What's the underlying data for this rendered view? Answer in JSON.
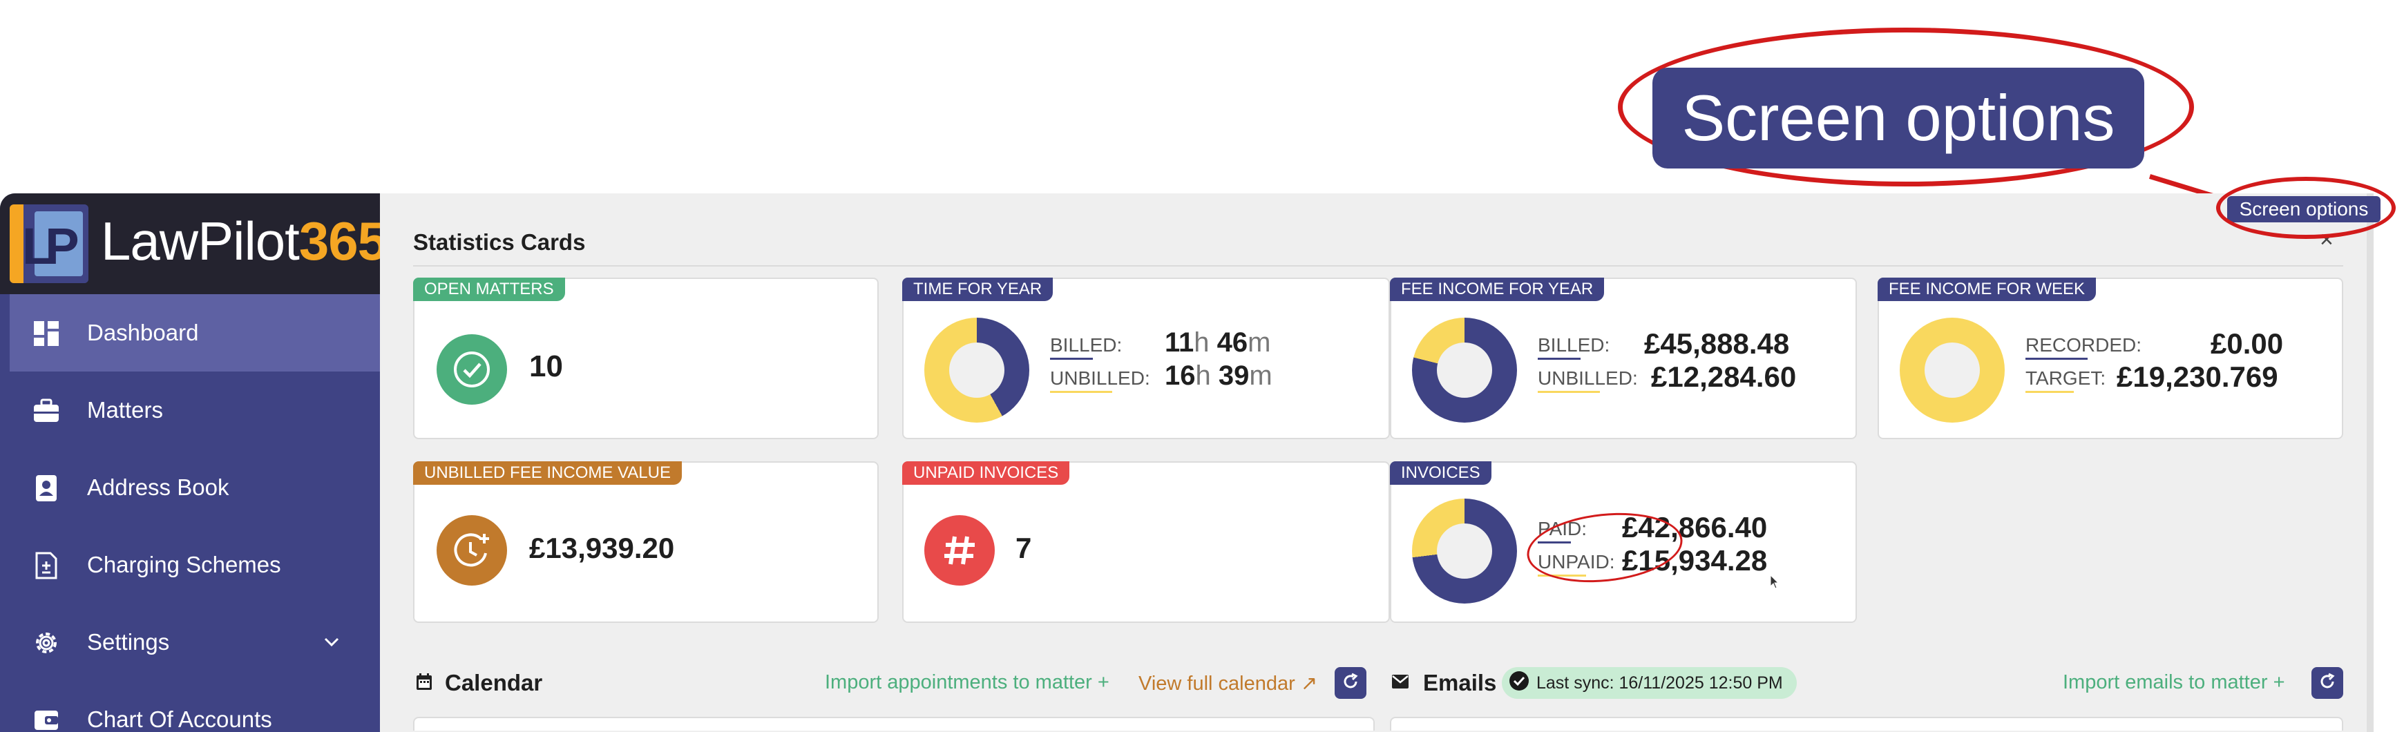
{
  "brand": {
    "name": "LawPilot",
    "number": "365",
    "mark": "LP"
  },
  "sidebar": {
    "items": [
      {
        "label": "Dashboard",
        "icon": "dashboard-icon",
        "active": true
      },
      {
        "label": "Matters",
        "icon": "briefcase-icon"
      },
      {
        "label": "Address Book",
        "icon": "contact-book-icon"
      },
      {
        "label": "Charging Schemes",
        "icon": "fee-document-icon"
      },
      {
        "label": "Settings",
        "icon": "gear-icon",
        "expandable": true
      },
      {
        "label": "Chart Of Accounts",
        "icon": "wallet-icon"
      }
    ]
  },
  "header": {
    "screen_options": "Screen options",
    "close": "×"
  },
  "stats_section": {
    "title": "Statistics Cards"
  },
  "cards": {
    "open_matters": {
      "tag": "OPEN MATTERS",
      "value": "10",
      "icon": "check-circle-icon",
      "color": "#4caf7d"
    },
    "time_for_year": {
      "tag": "TIME FOR YEAR",
      "billed_label": "BILLED:",
      "billed_h": "11",
      "billed_m": "46",
      "unbilled_label": "UNBILLED:",
      "unbilled_h": "16",
      "unbilled_m": "39",
      "h_unit": "h",
      "m_unit": "m",
      "billed_fraction": 0.42
    },
    "fee_income_year": {
      "tag": "FEE INCOME FOR YEAR",
      "billed_label": "BILLED:",
      "billed_value": "£45,888.48",
      "unbilled_label": "UNBILLED:",
      "unbilled_value": "£12,284.60",
      "billed_fraction": 0.79
    },
    "fee_income_week": {
      "tag": "FEE INCOME FOR WEEK",
      "recorded_label": "RECORDED:",
      "recorded_value": "£0.00",
      "target_label": "TARGET:",
      "target_value": "£19,230.769",
      "recorded_fraction": 0
    },
    "unbilled_fee_income": {
      "tag": "UNBILLED FEE INCOME VALUE",
      "value": "£13,939.20",
      "icon": "clock-plus-icon",
      "color": "#c17a2c"
    },
    "unpaid_invoices": {
      "tag": "UNPAID INVOICES",
      "value": "7",
      "icon": "hash-icon",
      "color": "#e84a4a"
    },
    "invoices": {
      "tag": "INVOICES",
      "paid_label": "PAID:",
      "paid_value": "£42,866.40",
      "unpaid_label": "UNPAID:",
      "unpaid_value": "£15,934.28",
      "paid_fraction": 0.73
    }
  },
  "calendar": {
    "title": "Calendar",
    "import_link": "Import appointments to matter",
    "view_link": "View full calendar"
  },
  "emails": {
    "title": "Emails",
    "last_sync": "Last sync: 16/11/2025 12:50 PM",
    "import_link": "Import emails to matter"
  },
  "colors": {
    "navy": "#3f4384",
    "yellow": "#f9d85e",
    "green": "#4caf7d",
    "orange": "#c17a2c",
    "red": "#e84a4a",
    "annotation": "#d21b1b"
  }
}
